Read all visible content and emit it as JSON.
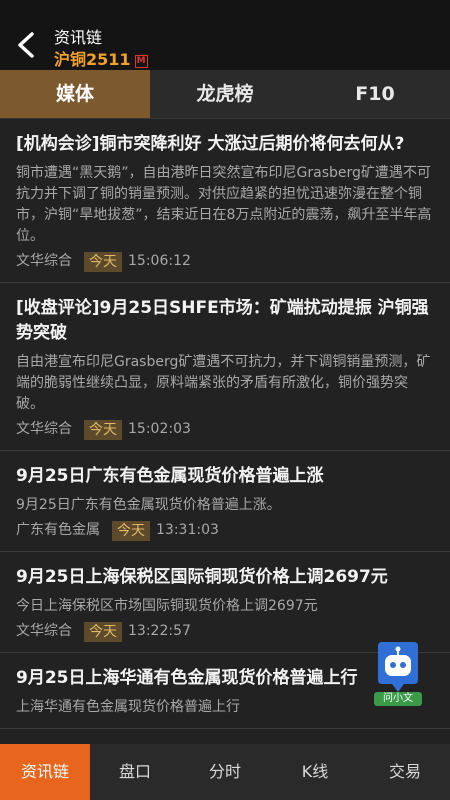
{
  "header": {
    "title": "资讯链",
    "subtitle": "沪铜2511",
    "badge": "M"
  },
  "tabs": [
    {
      "label": "媒体"
    },
    {
      "label": "龙虎榜"
    },
    {
      "label": "F10"
    }
  ],
  "news": [
    {
      "title": "[机构会诊]铜市突降利好 大涨过后期价将何去何从?",
      "summary": "铜市遭遇“黑天鹅”，自由港昨日突然宣布印尼Grasberg矿遭遇不可抗力并下调了铜的销量预测。对供应趋紧的担忧迅速弥漫在整个铜市，沪铜“旱地拔葱”，结束近日在8万点附近的震荡，飙升至半年高位。",
      "source": "文华综合",
      "tag": "今天",
      "time": "15:06:12"
    },
    {
      "title": "[收盘评论]9月25日SHFE市场：矿端扰动提振 沪铜强势突破",
      "summary": "自由港宣布印尼Grasberg矿遭遇不可抗力，并下调铜销量预测，矿端的脆弱性继续凸显，原料端紧张的矛盾有所激化，铜价强势突破。",
      "source": "文华综合",
      "tag": "今天",
      "time": "15:02:03"
    },
    {
      "title": "9月25日广东有色金属现货价格普遍上涨",
      "summary": "9月25日广东有色金属现货价格普遍上涨。",
      "source": "广东有色金属",
      "tag": "今天",
      "time": "13:31:03"
    },
    {
      "title": "9月25日上海保税区国际铜现货价格上调2697元",
      "summary": "今日上海保税区市场国际铜现货价格上调2697元",
      "source": "文华综合",
      "tag": "今天",
      "time": "13:22:57"
    },
    {
      "title": "9月25日上海华通有色金属现货价格普遍上行",
      "summary": "上海华通有色金属现货价格普遍上行",
      "source": "",
      "tag": "",
      "time": ""
    }
  ],
  "assistant": {
    "label": "问小文"
  },
  "bottom_nav": [
    {
      "label": "资讯链"
    },
    {
      "label": "盘口"
    },
    {
      "label": "分时"
    },
    {
      "label": "K线"
    },
    {
      "label": "交易"
    }
  ],
  "colors": {
    "accent": "#e8651d",
    "tab_active": "#7d5a2e",
    "subtitle": "#f1a12c"
  }
}
